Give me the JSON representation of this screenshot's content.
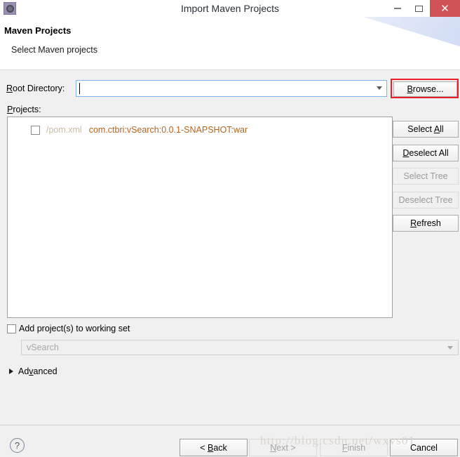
{
  "window": {
    "title": "Import Maven Projects",
    "icon": "maven-gear-icon",
    "minimize_label": "–",
    "maximize_label": "□",
    "close_label": "✕"
  },
  "header": {
    "title": "Maven Projects",
    "subtitle": "Select Maven projects"
  },
  "form": {
    "root_directory_label": "Root Directory:",
    "root_directory_label_mnemonic": "R",
    "root_directory_label_rest": "oot Directory:",
    "root_directory_value": "",
    "root_directory_placeholder": "",
    "browse_label_mnemonic": "B",
    "browse_label_rest": "rowse...",
    "browse_label": "Browse...",
    "projects_label": "Projects:",
    "projects_label_mnemonic": "P",
    "projects_label_rest": "rojects:"
  },
  "projects": [
    {
      "checked": false,
      "pom": "/pom.xml",
      "artifact": "com.ctbri:vSearch:0.0.1-SNAPSHOT:war"
    }
  ],
  "side_buttons": [
    {
      "label": "Select All",
      "mnemonic_pre": "Select ",
      "mnemonic": "A",
      "mnemonic_post": "ll",
      "enabled": true
    },
    {
      "label": "Deselect All",
      "mnemonic_pre": "",
      "mnemonic": "D",
      "mnemonic_post": "eselect All",
      "enabled": true
    },
    {
      "label": "Select Tree",
      "mnemonic_pre": "Select Tree",
      "mnemonic": "",
      "mnemonic_post": "",
      "enabled": false
    },
    {
      "label": "Deselect Tree",
      "mnemonic_pre": "Deselect Tree",
      "mnemonic": "",
      "mnemonic_post": "",
      "enabled": false
    },
    {
      "label": "Refresh",
      "mnemonic_pre": "",
      "mnemonic": "R",
      "mnemonic_post": "efresh",
      "enabled": true
    }
  ],
  "working_set": {
    "checkbox_label": "Add project(s) to working set",
    "checked": false,
    "selected_value": "vSearch",
    "enabled": false
  },
  "advanced": {
    "label_pre": "Ad",
    "label_mnemonic": "v",
    "label_post": "anced",
    "label": "Advanced",
    "expanded": false
  },
  "footer": {
    "help_label": "?",
    "buttons": [
      {
        "label": "< Back",
        "pre": "< ",
        "mnemonic": "B",
        "post": "ack",
        "enabled": true
      },
      {
        "label": "Next >",
        "pre": "",
        "mnemonic": "N",
        "post": "ext >",
        "enabled": false
      },
      {
        "label": "Finish",
        "pre": "",
        "mnemonic": "F",
        "post": "inish",
        "enabled": false
      },
      {
        "label": "Cancel",
        "pre": "Cancel",
        "mnemonic": "",
        "post": "",
        "enabled": true
      }
    ]
  },
  "watermark": {
    "text": "http://blog.csdn.net/wxvs01"
  },
  "colors": {
    "annotation_red": "#ee1c25",
    "close_button": "#cf5255",
    "artifact_text": "#b5651d",
    "pom_text": "#c9bca6",
    "focus_border": "#7eb4ea",
    "dialog_bg": "#f0f0f0"
  }
}
